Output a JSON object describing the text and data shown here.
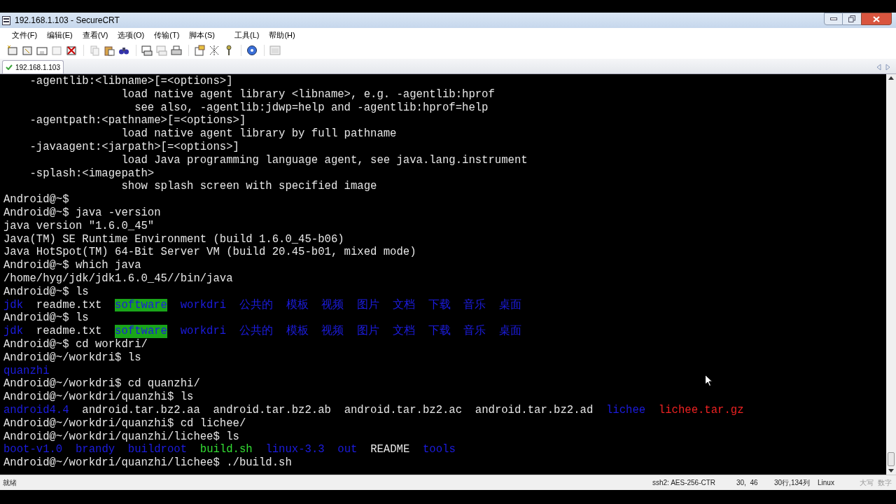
{
  "window": {
    "title": "192.168.1.103 - SecureCRT"
  },
  "menu": [
    "文件(F)",
    "编辑(E)",
    "查看(V)",
    "选项(O)",
    "传输(T)",
    "脚本(S)",
    "工具(L)",
    "帮助(H)"
  ],
  "tabs": [
    {
      "label": "192.168.1.103",
      "selected": true,
      "connected": true
    }
  ],
  "terminal": {
    "lines": [
      [
        {
          "text": "    -agentlib:<libname>[=<options>]"
        }
      ],
      [
        {
          "text": "                  load native agent library <libname>, e.g. -agentlib:hprof"
        }
      ],
      [
        {
          "text": "                    see also, -agentlib:jdwp=help and -agentlib:hprof=help"
        }
      ],
      [
        {
          "text": "    -agentpath:<pathname>[=<options>]"
        }
      ],
      [
        {
          "text": "                  load native agent library by full pathname"
        }
      ],
      [
        {
          "text": "    -javaagent:<jarpath>[=<options>]"
        }
      ],
      [
        {
          "text": "                  load Java programming language agent, see java.lang.instrument"
        }
      ],
      [
        {
          "text": "    -splash:<imagepath>"
        }
      ],
      [
        {
          "text": "                  show splash screen with specified image"
        }
      ],
      [
        {
          "text": "Android@~$"
        }
      ],
      [
        {
          "text": "Android@~$ java -version"
        }
      ],
      [
        {
          "text": "java version \"1.6.0_45\""
        }
      ],
      [
        {
          "text": "Java(TM) SE Runtime Environment (build 1.6.0_45-b06)"
        }
      ],
      [
        {
          "text": "Java HotSpot(TM) 64-Bit Server VM (build 20.45-b01, mixed mode)"
        }
      ],
      [
        {
          "text": "Android@~$ which java"
        }
      ],
      [
        {
          "text": "/home/hyg/jdk/jdk1.6.0_45//bin/java"
        }
      ],
      [
        {
          "text": "Android@~$ ls"
        }
      ],
      [
        {
          "text": "jdk",
          "color": "#1c1ce0",
          "highlighted": false
        },
        {
          "text": "readme.txt",
          "highlighted": false
        },
        {
          "text": "software",
          "color": "#1aa51a",
          "highlighted": true
        },
        {
          "text": "workdri",
          "color": "#1c1ce0",
          "highlighted": false
        },
        {
          "text": "公共的",
          "color": "#1c1ce0",
          "highlighted": false
        },
        {
          "text": "模板",
          "color": "#1c1ce0",
          "highlighted": false
        },
        {
          "text": "视频",
          "color": "#1c1ce0",
          "highlighted": false
        },
        {
          "text": "图片",
          "color": "#1c1ce0",
          "highlighted": false
        },
        {
          "text": "文档",
          "color": "#1c1ce0",
          "highlighted": false
        },
        {
          "text": "下载",
          "color": "#1c1ce0",
          "highlighted": false
        },
        {
          "text": "音乐",
          "color": "#1c1ce0",
          "highlighted": false
        },
        {
          "text": "桌面",
          "color": "#1c1ce0",
          "highlighted": false
        }
      ],
      [
        {
          "text": "Android@~$ ls"
        }
      ],
      [
        {
          "text": "jdk",
          "color": "#1c1ce0",
          "highlighted": false
        },
        {
          "text": "readme.txt",
          "highlighted": false
        },
        {
          "text": "software",
          "color": "#1aa51a",
          "highlighted": true
        },
        {
          "text": "workdri",
          "color": "#1c1ce0",
          "highlighted": false
        },
        {
          "text": "公共的",
          "color": "#1c1ce0",
          "highlighted": false
        },
        {
          "text": "模板",
          "color": "#1c1ce0",
          "highlighted": false
        },
        {
          "text": "视频",
          "color": "#1c1ce0",
          "highlighted": false
        },
        {
          "text": "图片",
          "color": "#1c1ce0",
          "highlighted": false
        },
        {
          "text": "文档",
          "color": "#1c1ce0",
          "highlighted": false
        },
        {
          "text": "下载",
          "color": "#1c1ce0",
          "highlighted": false
        },
        {
          "text": "音乐",
          "color": "#1c1ce0",
          "highlighted": false
        },
        {
          "text": "桌面",
          "color": "#1c1ce0",
          "highlighted": false
        }
      ],
      [
        {
          "text": "Android@~$ cd workdri/"
        }
      ],
      [
        {
          "text": "Android@~/workdri$ ls"
        }
      ],
      [
        {
          "text": "quanzhi",
          "color": "#1c1ce0"
        }
      ],
      [
        {
          "text": "Android@~/workdri$ cd quanzhi/"
        }
      ],
      [
        {
          "text": "Android@~/workdri/quanzhi$ ls"
        }
      ],
      [
        {
          "text": "android4.4",
          "color": "#1c1ce0"
        },
        {
          "text": "android.tar.bz2.aa"
        },
        {
          "text": "android.tar.bz2.ab"
        },
        {
          "text": "android.tar.bz2.ac"
        },
        {
          "text": "android.tar.bz2.ad"
        },
        {
          "text": "lichee",
          "color": "#1c1ce0"
        },
        {
          "text": "lichee.tar.gz",
          "color": "#ee2222"
        }
      ],
      [
        {
          "text": "Android@~/workdri/quanzhi$ cd lichee/"
        }
      ],
      [
        {
          "text": "Android@~/workdri/quanzhi/lichee$ ls"
        }
      ],
      [
        {
          "text": "boot-v1.0",
          "color": "#1c1ce0"
        },
        {
          "text": "brandy",
          "color": "#1c1ce0"
        },
        {
          "text": "buildroot",
          "color": "#1c1ce0"
        },
        {
          "text": "build.sh",
          "color": "#33dd33"
        },
        {
          "text": "linux-3.3",
          "color": "#1c1ce0"
        },
        {
          "text": "out",
          "color": "#1c1ce0"
        },
        {
          "text": "README"
        },
        {
          "text": "tools",
          "color": "#1c1ce0"
        }
      ],
      [
        {
          "text": "Android@~/workdri/quanzhi/lichee$ ./build.sh"
        }
      ]
    ]
  },
  "status_bar": {
    "left": "就绪",
    "items": [
      "ssh2: AES-256-CTR",
      "30,  46",
      "30行,134列",
      "Linux"
    ],
    "keys": [
      "大写",
      "数字"
    ]
  }
}
